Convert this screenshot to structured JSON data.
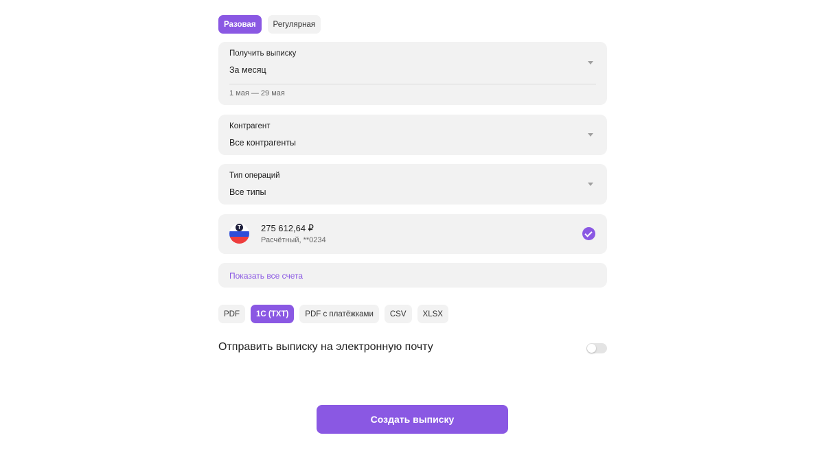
{
  "statement_type_tabs": [
    {
      "label": "Разовая",
      "active": true
    },
    {
      "label": "Регулярная",
      "active": false
    }
  ],
  "period": {
    "label": "Получить выписку",
    "value": "За месяц",
    "range": "1 мая — 29 мая"
  },
  "counterparty": {
    "label": "Контрагент",
    "value": "Все контрагенты"
  },
  "operation_type": {
    "label": "Тип операций",
    "value": "Все типы"
  },
  "account": {
    "logo_letter": "T",
    "amount": "275 612,64 ₽",
    "description": "Расчётный, **0234",
    "selected": true
  },
  "show_all_accounts": "Показать все счета",
  "formats": [
    {
      "label": "PDF",
      "active": false
    },
    {
      "label": "1С (TXT)",
      "active": true
    },
    {
      "label": "PDF с платёжками",
      "active": false
    },
    {
      "label": "CSV",
      "active": false
    },
    {
      "label": "XLSX",
      "active": false
    }
  ],
  "email": {
    "label": "Отправить выписку на электронную почту",
    "enabled": false
  },
  "create_button": "Создать выписку",
  "colors": {
    "accent": "#8a58e3",
    "field_bg": "#f2f2f2"
  }
}
